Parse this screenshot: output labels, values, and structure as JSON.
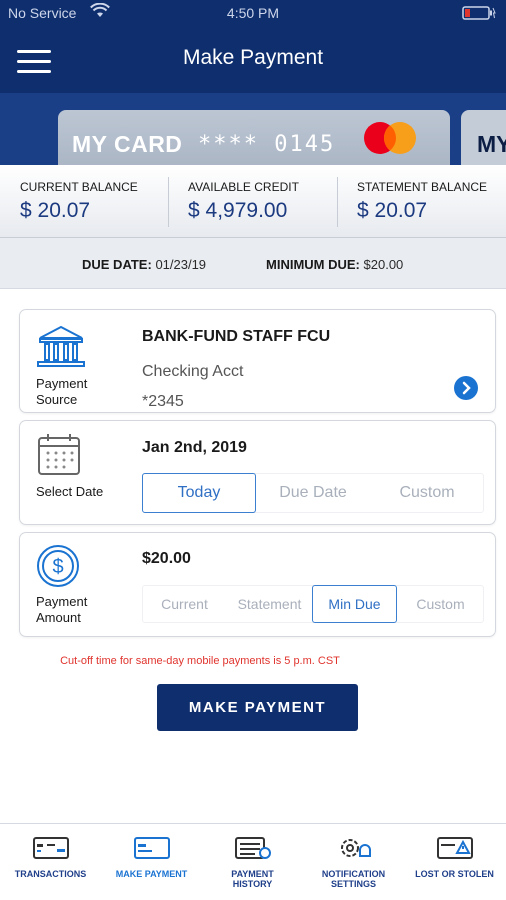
{
  "status_bar": {
    "carrier": "No Service",
    "time": "4:50 PM"
  },
  "header": {
    "title": "Make Payment"
  },
  "card": {
    "name": "MY CARD",
    "number": "**** 0145",
    "brand": "mastercard",
    "next_card_name": "MY"
  },
  "balances": [
    {
      "label": "CURRENT BALANCE",
      "value": "$ 20.07"
    },
    {
      "label": "AVAILABLE CREDIT",
      "value": "$ 4,979.00"
    },
    {
      "label": "STATEMENT BALANCE",
      "value": "$ 20.07"
    }
  ],
  "due": {
    "due_date_label": "DUE DATE:",
    "due_date": "01/23/19",
    "min_due_label": "MINIMUM DUE:",
    "min_due": "$20.00"
  },
  "source": {
    "label": "Payment Source",
    "bank": "BANK-FUND STAFF FCU",
    "account": "Checking Acct",
    "number": "*2345"
  },
  "date": {
    "label": "Select Date",
    "value": "Jan 2nd, 2019",
    "options": [
      "Today",
      "Due Date",
      "Custom"
    ],
    "selected": "Today"
  },
  "amount": {
    "label": "Payment Amount",
    "value": "$20.00",
    "options": [
      "Current",
      "Statement",
      "Min Due",
      "Custom"
    ],
    "selected": "Min Due"
  },
  "cutoff_note": "Cut-off time for same-day mobile payments is 5 p.m. CST",
  "make_payment_label": "MAKE PAYMENT",
  "tabs": [
    {
      "label": "TRANSACTIONS",
      "icon": "transactions-icon"
    },
    {
      "label": "MAKE PAYMENT",
      "icon": "make-payment-icon"
    },
    {
      "label": "PAYMENT HISTORY",
      "icon": "payment-history-icon"
    },
    {
      "label": "NOTIFICATION SETTINGS",
      "icon": "notification-settings-icon"
    },
    {
      "label": "LOST OR STOLEN",
      "icon": "lost-or-stolen-icon"
    }
  ],
  "colors": {
    "navy": "#0f2e6e",
    "accent_blue": "#1a73d1",
    "value_blue": "#1c3a80",
    "warning_red": "#e0342e"
  }
}
